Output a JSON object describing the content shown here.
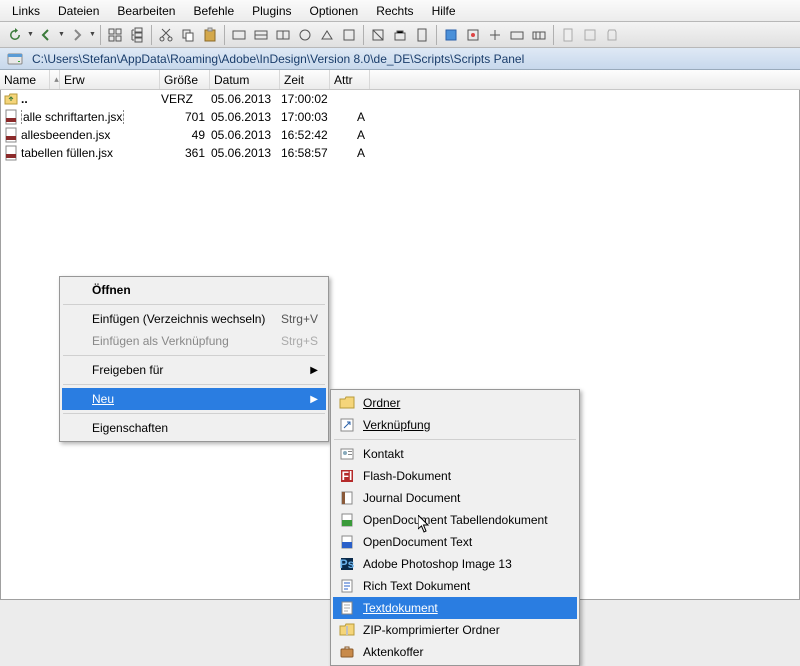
{
  "menubar": [
    "Links",
    "Dateien",
    "Bearbeiten",
    "Befehle",
    "Plugins",
    "Optionen",
    "Rechts",
    "Hilfe"
  ],
  "path": "C:\\Users\\Stefan\\AppData\\Roaming\\Adobe\\InDesign\\Version 8.0\\de_DE\\Scripts\\Scripts Panel",
  "columns": {
    "name": "Name",
    "erw": "Erw",
    "groesse": "Größe",
    "datum": "Datum",
    "zeit": "Zeit",
    "attr": "Attr"
  },
  "files": [
    {
      "name": "..",
      "size": "",
      "verz": "VERZ",
      "date": "05.06.2013",
      "time": "17:00:02",
      "attr": ""
    },
    {
      "name": "alle schriftarten.jsx",
      "size": "701",
      "verz": "",
      "date": "05.06.2013",
      "time": "17:00:03",
      "attr": "A",
      "selected": true
    },
    {
      "name": "allesbeenden.jsx",
      "size": "49",
      "verz": "",
      "date": "05.06.2013",
      "time": "16:52:42",
      "attr": "A"
    },
    {
      "name": "tabellen füllen.jsx",
      "size": "361",
      "verz": "",
      "date": "05.06.2013",
      "time": "16:58:57",
      "attr": "A"
    }
  ],
  "ctx1": {
    "open": "Öffnen",
    "paste": "Einfügen (Verzeichnis wechseln)",
    "paste_sc": "Strg+V",
    "pastelink": "Einfügen als Verknüpfung",
    "pastelink_sc": "Strg+S",
    "share": "Freigeben für",
    "neu": "Neu",
    "props": "Eigenschaften"
  },
  "ctx2": {
    "ordner": "Ordner",
    "verkn": "Verknüpfung",
    "kontakt": "Kontakt",
    "flash": "Flash-Dokument",
    "journal": "Journal Document",
    "odt_tab": "OpenDocument Tabellendokument",
    "odt": "OpenDocument Text",
    "ps": "Adobe Photoshop Image 13",
    "rtf": "Rich Text Dokument",
    "txt": "Textdokument",
    "zip": "ZIP-komprimierter Ordner",
    "koffer": "Aktenkoffer"
  }
}
